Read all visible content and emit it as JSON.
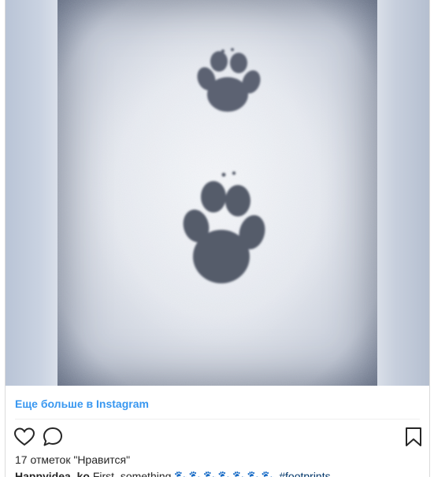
{
  "post": {
    "more_link": "Еще больше в Instagram",
    "likes": "17 отметок \"Нравится\"",
    "caption_user": "Happyidea_ko",
    "caption_text": "First, something",
    "caption_emojis": "🐾🐾🐾🐾🐾🐾🐾",
    "caption_tag": "#footprints"
  },
  "icons": {
    "like": "heart-icon",
    "comment": "comment-icon",
    "save": "bookmark-icon"
  },
  "colors": {
    "link": "#3897f0",
    "text": "#262626"
  }
}
